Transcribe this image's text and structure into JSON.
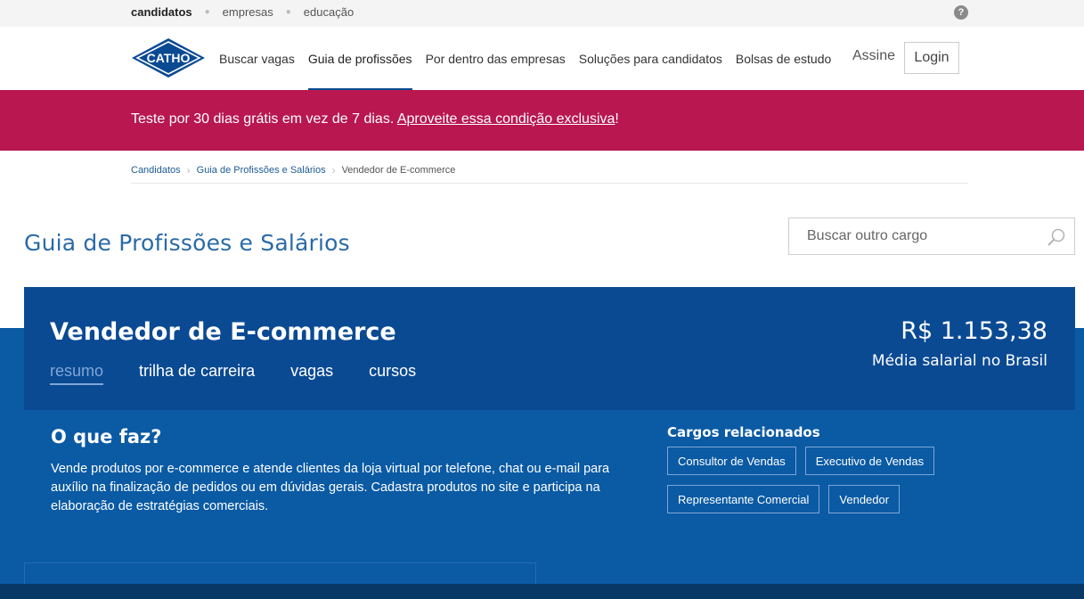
{
  "topbar": {
    "links": [
      "candidatos",
      "empresas",
      "educação"
    ],
    "active_index": 0,
    "help_label": "?"
  },
  "header": {
    "logo_text": "CATHO",
    "nav": [
      {
        "label": "Buscar vagas",
        "active": false
      },
      {
        "label": "Guia de profissões",
        "active": true
      },
      {
        "label": "Por dentro das empresas",
        "active": false
      },
      {
        "label": "Soluções para candidatos",
        "active": false
      },
      {
        "label": "Bolsas de estudo",
        "active": false
      }
    ],
    "assine_label": "Assine",
    "login_label": "Login"
  },
  "promo": {
    "text": "Teste por 30 dias grátis em vez de 7 dias. ",
    "link_text": "Aproveite essa condição exclusiva",
    "suffix": "!",
    "background": "#b8174f"
  },
  "breadcrumb": [
    {
      "label": "Candidatos"
    },
    {
      "label": "Guia de Profissões e Salários"
    },
    {
      "label": "Vendedor de E-commerce"
    }
  ],
  "page": {
    "title": "Guia de Profissões e Salários",
    "search_placeholder": "Buscar outro cargo"
  },
  "job": {
    "title": "Vendedor de E-commerce",
    "tabs": [
      {
        "label": "resumo",
        "active": true
      },
      {
        "label": "trilha de carreira",
        "active": false
      },
      {
        "label": "vagas",
        "active": false
      },
      {
        "label": "cursos",
        "active": false
      }
    ],
    "salary": "R$ 1.153,38",
    "salary_label": "Média salarial no Brasil"
  },
  "summary": {
    "heading": "O que faz?",
    "description": "Vende produtos por e-commerce e atende clientes da loja virtual por telefone, chat ou e-mail para auxílio na finalização de pedidos ou em dúvidas gerais. Cadastra produtos no site e participa na elaboração de estratégias comerciais."
  },
  "related": {
    "heading": "Cargos relacionados",
    "items": [
      "Consultor de Vendas",
      "Executivo de Vendas",
      "Representante Comercial",
      "Vendedor"
    ]
  },
  "colors": {
    "brand_blue": "#0a4a93",
    "content_blue": "#0a5aa4",
    "title_blue": "#2a6aa8",
    "promo_magenta": "#b8174f"
  }
}
